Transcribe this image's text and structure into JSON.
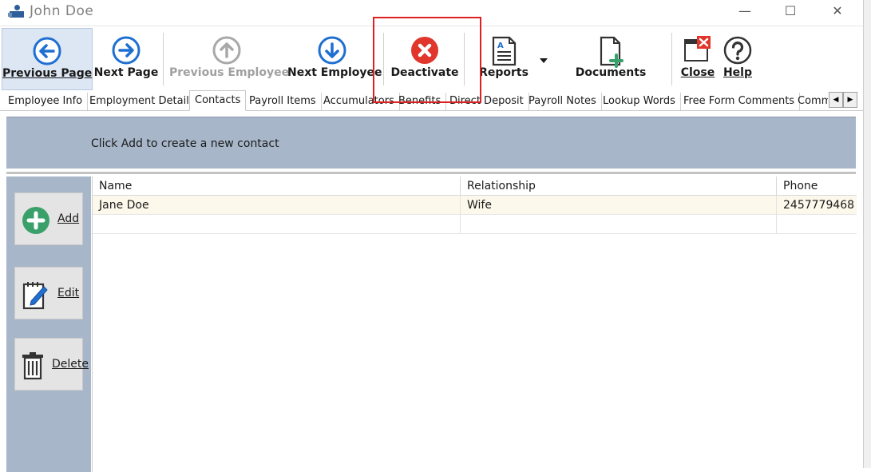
{
  "window": {
    "title": "John  Doe",
    "controls": {
      "minimize": "—",
      "maximize": "☐",
      "close": "✕"
    }
  },
  "toolbar": {
    "previous_page": "Previous Page",
    "next_page": "Next Page",
    "previous_employee": "Previous Employee",
    "next_employee": "Next Employee",
    "deactivate": "Deactivate",
    "reports": "Reports",
    "documents": "Documents",
    "close": "Close",
    "help": "Help",
    "accent_blue": "#1f6fd1",
    "deactivate_red": "#e0362b",
    "disabled_gray": "#a0a0a0"
  },
  "tabs": [
    {
      "label": "Employee Info"
    },
    {
      "label": "Employment Details"
    },
    {
      "label": "Contacts",
      "active": true
    },
    {
      "label": "Payroll Items"
    },
    {
      "label": "Accumulators"
    },
    {
      "label": "Benefits"
    },
    {
      "label": "Direct Deposit"
    },
    {
      "label": "Payroll Notes"
    },
    {
      "label": "Lookup Words"
    },
    {
      "label": "Free Form Comments"
    },
    {
      "label": "Comm"
    }
  ],
  "contacts": {
    "banner_text": "Click Add to create a new contact",
    "buttons": {
      "add": "Add",
      "edit": "Edit",
      "delete": "Delete"
    },
    "columns": [
      "Name",
      "Relationship",
      "Phone"
    ],
    "rows": [
      {
        "name": "Jane Doe",
        "relationship": "Wife",
        "phone": "2457779468"
      }
    ]
  },
  "colors": {
    "banner_bg": "#a7b7c9",
    "selected_row": "#fdf8ec",
    "highlight_box": "#e02020",
    "add_green": "#3aa06a"
  },
  "icons": [
    "app-icon",
    "arrow-left-circle-icon",
    "arrow-right-circle-icon",
    "arrow-up-circle-icon",
    "arrow-down-circle-icon",
    "x-circle-icon",
    "report-document-icon",
    "dropdown-arrow-icon",
    "document-add-icon",
    "close-window-icon",
    "question-circle-icon",
    "plus-circle-icon",
    "edit-notepad-icon",
    "trash-icon"
  ]
}
